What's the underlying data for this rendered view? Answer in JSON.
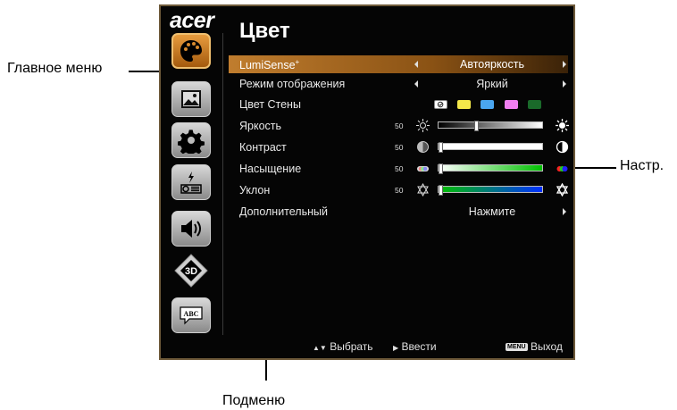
{
  "callouts": {
    "main_menu": "Главное меню",
    "settings": "Настр.",
    "submenu": "Подменю"
  },
  "osd": {
    "logo": "acer",
    "title": "Цвет",
    "sidebar_icons": [
      "palette-icon",
      "picture-icon",
      "gear-icon",
      "projector-power-icon",
      "speaker-icon",
      "3d-icon",
      "language-abc-icon"
    ],
    "rows": [
      {
        "label": "LumiSense",
        "sup": "+",
        "value": "Автояркость"
      },
      {
        "label": "Режим отображения",
        "value": "Яркий"
      },
      {
        "label": "Цвет Стены"
      },
      {
        "label": "Яркость",
        "number": "50",
        "level": 0.35
      },
      {
        "label": "Контраст",
        "number": "50",
        "level": 0.0
      },
      {
        "label": "Насыщение",
        "number": "50",
        "level": 0.0
      },
      {
        "label": "Уклон",
        "number": "50",
        "level": 0.0
      },
      {
        "label": "Дополнительный",
        "value": "Нажмите"
      }
    ],
    "wall_colors": [
      "#ffffff",
      "#f4e84a",
      "#4aa6f0",
      "#f07ef0",
      "#1a6a2a"
    ],
    "footer": {
      "select": "Выбрать",
      "enter": "Ввести",
      "menu_key": "MENU",
      "exit": "Выход"
    }
  },
  "colors": {
    "accent": "#c07d2e",
    "osd_bg": "#050505"
  }
}
